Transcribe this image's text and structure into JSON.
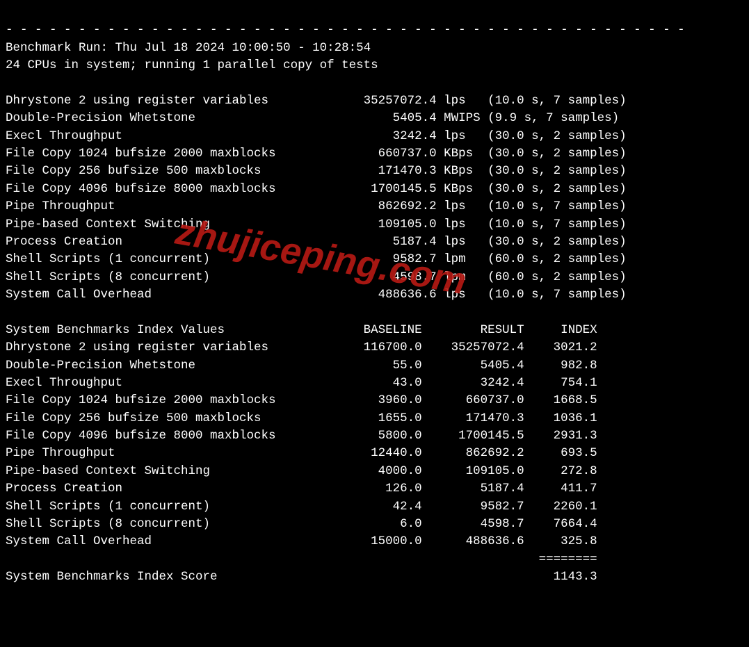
{
  "watermark": "zhujiceping.com",
  "separator": "- - - - - - - - - - - - - - - - - - - - - - - - - - - - - - - - - - - - - - - - - - - - - - -",
  "header": {
    "run_line": "Benchmark Run: Thu Jul 18 2024 10:00:50 - 10:28:54",
    "cpu_line": "24 CPUs in system; running 1 parallel copy of tests"
  },
  "test_table": {
    "col_widths": {
      "name": 42,
      "value": 17,
      "unit": 6,
      "note": 21
    },
    "rows": [
      {
        "name": "Dhrystone 2 using register variables",
        "value": "35257072.4",
        "unit": "lps",
        "note": "(10.0 s, 7 samples)"
      },
      {
        "name": "Double-Precision Whetstone",
        "value": "5405.4",
        "unit": "MWIPS",
        "note": "(9.9 s, 7 samples)"
      },
      {
        "name": "Execl Throughput",
        "value": "3242.4",
        "unit": "lps",
        "note": "(30.0 s, 2 samples)"
      },
      {
        "name": "File Copy 1024 bufsize 2000 maxblocks",
        "value": "660737.0",
        "unit": "KBps",
        "note": "(30.0 s, 2 samples)"
      },
      {
        "name": "File Copy 256 bufsize 500 maxblocks",
        "value": "171470.3",
        "unit": "KBps",
        "note": "(30.0 s, 2 samples)"
      },
      {
        "name": "File Copy 4096 bufsize 8000 maxblocks",
        "value": "1700145.5",
        "unit": "KBps",
        "note": "(30.0 s, 2 samples)"
      },
      {
        "name": "Pipe Throughput",
        "value": "862692.2",
        "unit": "lps",
        "note": "(10.0 s, 7 samples)"
      },
      {
        "name": "Pipe-based Context Switching",
        "value": "109105.0",
        "unit": "lps",
        "note": "(10.0 s, 7 samples)"
      },
      {
        "name": "Process Creation",
        "value": "5187.4",
        "unit": "lps",
        "note": "(30.0 s, 2 samples)"
      },
      {
        "name": "Shell Scripts (1 concurrent)",
        "value": "9582.7",
        "unit": "lpm",
        "note": "(60.0 s, 2 samples)"
      },
      {
        "name": "Shell Scripts (8 concurrent)",
        "value": "4598.7",
        "unit": "lpm",
        "note": "(60.0 s, 2 samples)"
      },
      {
        "name": "System Call Overhead",
        "value": "488636.6",
        "unit": "lps",
        "note": "(10.0 s, 7 samples)"
      }
    ]
  },
  "index_table": {
    "col_widths": {
      "name": 42,
      "baseline": 15,
      "result": 14,
      "index": 10
    },
    "header": {
      "name": "System Benchmarks Index Values",
      "baseline": "BASELINE",
      "result": "RESULT",
      "index": "INDEX"
    },
    "rows": [
      {
        "name": "Dhrystone 2 using register variables",
        "baseline": "116700.0",
        "result": "35257072.4",
        "index": "3021.2"
      },
      {
        "name": "Double-Precision Whetstone",
        "baseline": "55.0",
        "result": "5405.4",
        "index": "982.8"
      },
      {
        "name": "Execl Throughput",
        "baseline": "43.0",
        "result": "3242.4",
        "index": "754.1"
      },
      {
        "name": "File Copy 1024 bufsize 2000 maxblocks",
        "baseline": "3960.0",
        "result": "660737.0",
        "index": "1668.5"
      },
      {
        "name": "File Copy 256 bufsize 500 maxblocks",
        "baseline": "1655.0",
        "result": "171470.3",
        "index": "1036.1"
      },
      {
        "name": "File Copy 4096 bufsize 8000 maxblocks",
        "baseline": "5800.0",
        "result": "1700145.5",
        "index": "2931.3"
      },
      {
        "name": "Pipe Throughput",
        "baseline": "12440.0",
        "result": "862692.2",
        "index": "693.5"
      },
      {
        "name": "Pipe-based Context Switching",
        "baseline": "4000.0",
        "result": "109105.0",
        "index": "272.8"
      },
      {
        "name": "Process Creation",
        "baseline": "126.0",
        "result": "5187.4",
        "index": "411.7"
      },
      {
        "name": "Shell Scripts (1 concurrent)",
        "baseline": "42.4",
        "result": "9582.7",
        "index": "2260.1"
      },
      {
        "name": "Shell Scripts (8 concurrent)",
        "baseline": "6.0",
        "result": "4598.7",
        "index": "7664.4"
      },
      {
        "name": "System Call Overhead",
        "baseline": "15000.0",
        "result": "488636.6",
        "index": "325.8"
      }
    ],
    "underline": "========",
    "score_label": "System Benchmarks Index Score",
    "score_value": "1143.3"
  }
}
